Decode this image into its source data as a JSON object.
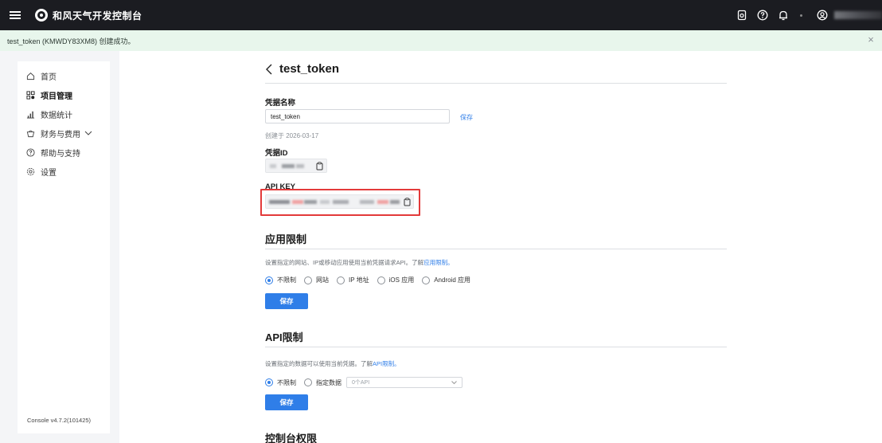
{
  "header": {
    "app_title": "和风天气开发控制台",
    "icons": [
      "menu-icon",
      "logo-icon",
      "document-icon",
      "help-icon",
      "bell-icon",
      "user-icon"
    ]
  },
  "banner": {
    "message": "test_token (KMWDY83XM8) 创建成功。",
    "close_symbol": "×"
  },
  "sidebar": {
    "items": [
      {
        "label": "首页",
        "icon": "home-icon"
      },
      {
        "label": "项目管理",
        "icon": "grid-icon",
        "active": true
      },
      {
        "label": "数据统计",
        "icon": "bar-chart-icon"
      },
      {
        "label": "财务与费用",
        "icon": "wallet-icon",
        "expandable": true
      },
      {
        "label": "帮助与支持",
        "icon": "help-circle-icon"
      },
      {
        "label": "设置",
        "icon": "settings-icon"
      }
    ],
    "version": "Console v4.7.2(101425)"
  },
  "main": {
    "title": "test_token",
    "credential_name_label": "凭据名称",
    "credential_name_value": "test_token",
    "save_link": "保存",
    "created_text": "创建于 2026-03-17",
    "credential_id_label": "凭据ID",
    "api_key_label": "API KEY",
    "app_restriction": {
      "title": "应用限制",
      "desc_prefix": "设置指定的网站、IP或移动应用使用当前凭据请求API。了解",
      "desc_link": "应用限制。",
      "options": [
        "不限制",
        "网站",
        "IP 地址",
        "iOS 应用",
        "Android 应用"
      ],
      "selected": "不限制",
      "save_button": "保存"
    },
    "api_restriction": {
      "title": "API限制",
      "desc_prefix": "设置指定的数据可以使用当前凭据。了解",
      "desc_link": "API限制。",
      "options": [
        "不限制",
        "指定数据"
      ],
      "selected": "不限制",
      "select_placeholder": "0个API",
      "save_button": "保存"
    },
    "console_permission_title": "控制台权限"
  },
  "colors": {
    "topbar_bg": "#1b1c21",
    "banner_bg": "#e8f6ec",
    "accent": "#2f7ee8",
    "highlight_border": "#e33a3a"
  }
}
